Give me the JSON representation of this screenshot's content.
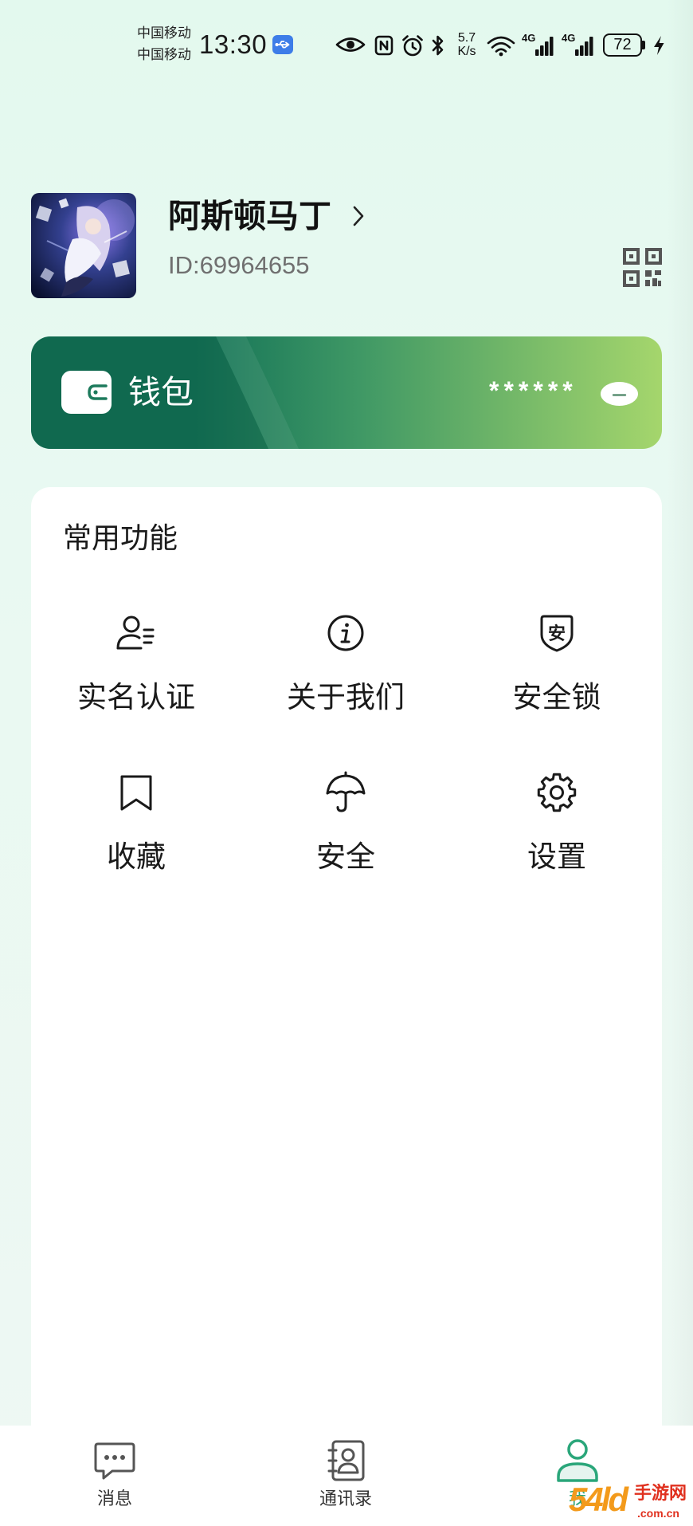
{
  "status_bar": {
    "carriers": [
      "中国移动",
      "中国移动"
    ],
    "time": "13:30",
    "net_speed": {
      "value": "5.7",
      "unit": "K/s"
    },
    "signals": [
      {
        "type": "4G"
      },
      {
        "type": "4G"
      }
    ],
    "battery_level": "72",
    "icons": {
      "usb": "usb-icon",
      "eye_comfort": "eye-icon",
      "nfc": "nfc-icon",
      "alarm": "alarm-icon",
      "bluetooth": "bluetooth-icon",
      "wifi": "wifi-icon",
      "signal": "signal-bars-icon",
      "battery": "battery-icon",
      "charging": "charging-bolt-icon"
    }
  },
  "profile": {
    "name": "阿斯顿马丁",
    "id_text": "ID:69964655",
    "icons": {
      "more": "chevron-right-icon",
      "qr": "qr-code-icon",
      "avatar": "avatar-image"
    }
  },
  "wallet": {
    "label": "钱包",
    "balance": "******",
    "balance_hidden": true,
    "icons": {
      "wallet": "wallet-icon",
      "toggle": "eye-closed-icon"
    }
  },
  "functions": {
    "title": "常用功能",
    "items": [
      {
        "label": "实名认证",
        "icon": "id-verify-icon"
      },
      {
        "label": "关于我们",
        "icon": "info-icon"
      },
      {
        "label": "安全锁",
        "icon": "shield-lock-icon",
        "glyph": "安"
      },
      {
        "label": "收藏",
        "icon": "bookmark-icon"
      },
      {
        "label": "安全",
        "icon": "umbrella-icon"
      },
      {
        "label": "设置",
        "icon": "gear-icon"
      }
    ]
  },
  "bottom_nav": {
    "items": [
      {
        "label": "消息",
        "icon": "chat-bubble-icon",
        "active": false
      },
      {
        "label": "通讯录",
        "icon": "contacts-book-icon",
        "active": false
      },
      {
        "label": "我",
        "icon": "person-icon",
        "active": true
      }
    ]
  },
  "watermark": {
    "brand": "54ld",
    "name": "手游网",
    "domain": ".com.cn"
  },
  "colors": {
    "page_bg": "#e9f8f1",
    "text": "#1a1a1a",
    "muted_text": "#707070",
    "accent": "#2aa67a",
    "usb_badge": "#3d7de8",
    "wallet_gradient": [
      "#137257",
      "#3f9865",
      "#a5d66c"
    ],
    "watermark_orange": "#f39a1b",
    "watermark_red": "#e0301e"
  }
}
